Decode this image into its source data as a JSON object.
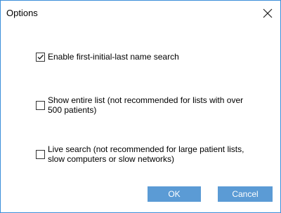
{
  "dialog": {
    "title": "Options",
    "options": [
      {
        "label": "Enable first-initial-last name search",
        "checked": true
      },
      {
        "label": "Show entire list (not recommended for lists with over 500 patients)",
        "checked": false
      },
      {
        "label": "Live search (not recommended for large patient lists, slow computers or slow networks)",
        "checked": false
      }
    ],
    "ok_label": "OK",
    "cancel_label": "Cancel"
  },
  "colors": {
    "window_border": "#3c8fd9",
    "button_bg": "#5b9bd5",
    "button_text": "#ffffff"
  },
  "icons": {
    "close": "close-icon",
    "check": "checkmark-icon"
  }
}
